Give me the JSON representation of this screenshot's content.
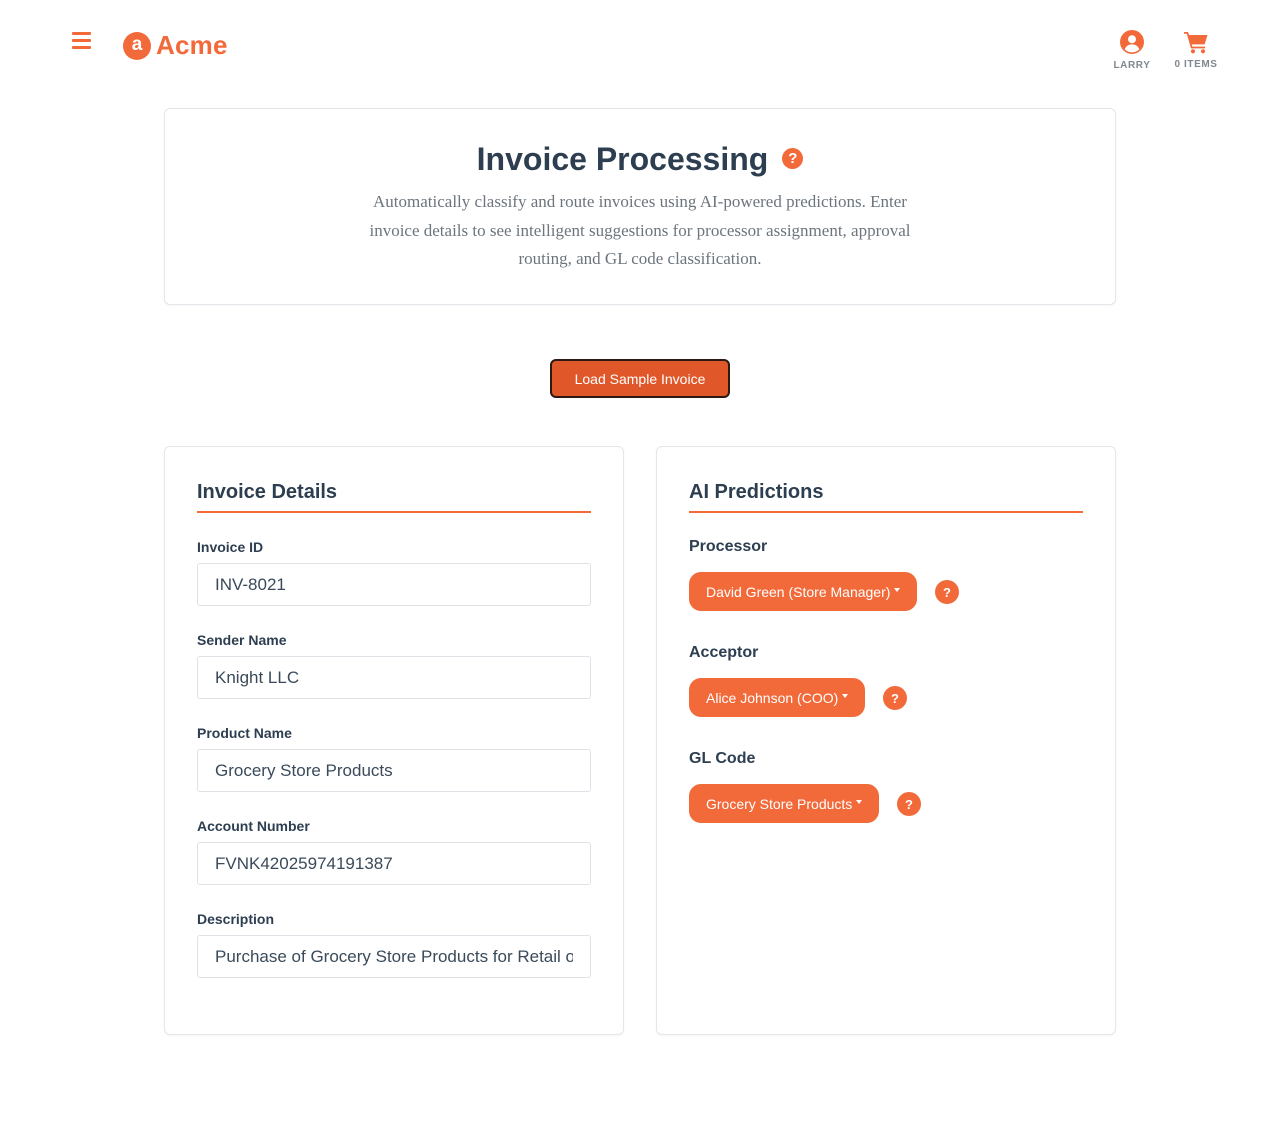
{
  "header": {
    "brand_letter": "a",
    "brand_name": "Acme",
    "user_label": "LARRY",
    "cart_label": "0 ITEMS",
    "accent_color": "#f26a3a",
    "icons": [
      "menu-icon",
      "user-circle-icon",
      "shopping-cart-icon"
    ]
  },
  "hero": {
    "title": "Invoice Processing",
    "help_glyph": "?",
    "subtitle": "Automatically classify and route invoices using AI-powered predictions. Enter invoice details to see intelligent suggestions for processor assignment, approval routing, and GL code classification."
  },
  "actions": {
    "load_sample_label": "Load Sample Invoice"
  },
  "invoice_details": {
    "title": "Invoice Details",
    "fields": [
      {
        "label": "Invoice ID",
        "value": "INV-8021"
      },
      {
        "label": "Sender Name",
        "value": "Knight LLC"
      },
      {
        "label": "Product Name",
        "value": "Grocery Store Products"
      },
      {
        "label": "Account Number",
        "value": "FVNK42025974191387"
      },
      {
        "label": "Description",
        "value": "Purchase of Grocery Store Products for Retail operations"
      }
    ]
  },
  "ai_predictions": {
    "title": "AI Predictions",
    "help_glyph": "?",
    "items": [
      {
        "label": "Processor",
        "selected": "David Green (Store Manager)"
      },
      {
        "label": "Acceptor",
        "selected": "Alice Johnson (COO)"
      },
      {
        "label": "GL Code",
        "selected": "Grocery Store Products"
      }
    ]
  }
}
